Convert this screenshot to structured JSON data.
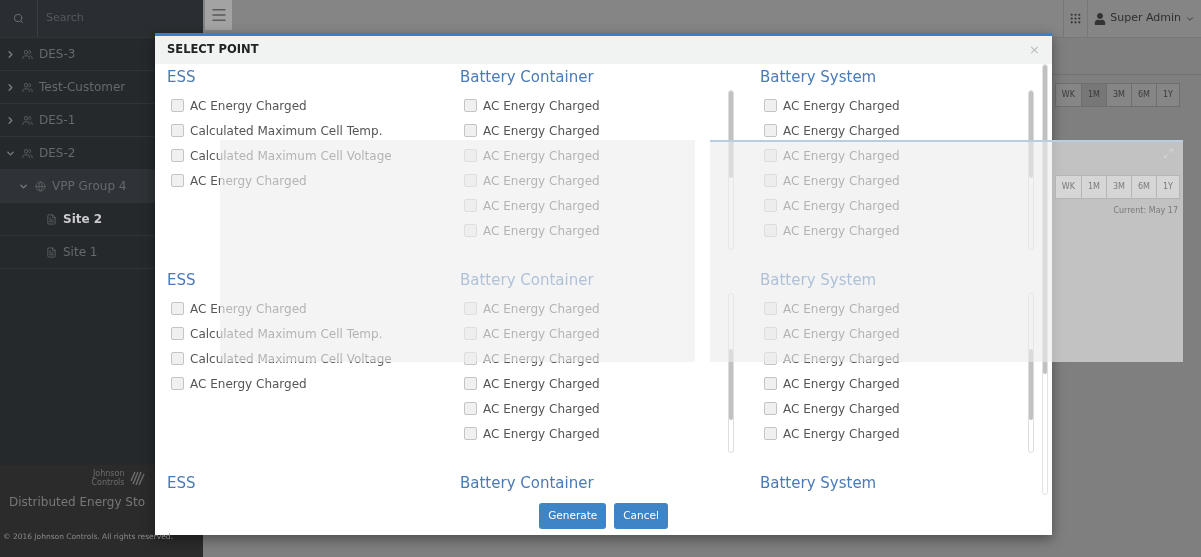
{
  "sidebar": {
    "search": {
      "placeholder": "Search"
    },
    "tree": [
      {
        "label": "DES-3",
        "kind": "customer",
        "expanded": false,
        "selected": false
      },
      {
        "label": "Test-Customer",
        "kind": "customer",
        "expanded": false,
        "selected": false
      },
      {
        "label": "DES-1",
        "kind": "customer",
        "expanded": false,
        "selected": false
      },
      {
        "label": "DES-2",
        "kind": "customer",
        "expanded": true,
        "selected": false,
        "children": [
          {
            "label": "VPP Group 4",
            "kind": "group",
            "expanded": true,
            "selected": false,
            "children": [
              {
                "label": "Site 2",
                "kind": "site",
                "selected": true
              },
              {
                "label": "Site 1",
                "kind": "site",
                "selected": false
              }
            ]
          }
        ]
      }
    ],
    "logo_text": "Johnson Controls",
    "product": "Distributed Energy Sto",
    "copyright": "© 2016 Johnson Controls. All rights reserved."
  },
  "topbar": {
    "user": "Super Admin"
  },
  "background": {
    "range_buttons": [
      {
        "label": "WK",
        "selected": false
      },
      {
        "label": "1M",
        "selected": true
      },
      {
        "label": "3M",
        "selected": false
      },
      {
        "label": "6M",
        "selected": false
      },
      {
        "label": "1Y",
        "selected": false
      }
    ],
    "card": {
      "range_buttons": [
        {
          "label": "WK"
        },
        {
          "label": "1M"
        },
        {
          "label": "3M"
        },
        {
          "label": "6M"
        },
        {
          "label": "1Y"
        }
      ],
      "current": "Current: May 17"
    }
  },
  "modal": {
    "title": "SELECT POINT",
    "close": "×",
    "rows": [
      {
        "groups": [
          {
            "title": "ESS",
            "points": [
              {
                "label": "AC Energy Charged",
                "checked": false
              },
              {
                "label": "Calculated Maximum Cell Temp.",
                "checked": false
              },
              {
                "label": "Calculated Maximum Cell Voltage",
                "checked": false
              },
              {
                "label": "AC Energy Charged",
                "checked": false
              }
            ]
          },
          {
            "title": "Battery Container",
            "points": [
              {
                "label": "AC Energy Charged",
                "checked": false
              },
              {
                "label": "AC Energy Charged",
                "checked": false
              },
              {
                "label": "AC Energy Charged",
                "checked": false
              },
              {
                "label": "AC Energy Charged",
                "checked": false
              },
              {
                "label": "AC Energy Charged",
                "checked": false
              },
              {
                "label": "AC Energy Charged",
                "checked": false
              }
            ]
          },
          {
            "title": "Battery System",
            "points": [
              {
                "label": "AC Energy Charged",
                "checked": false
              },
              {
                "label": "AC Energy Charged",
                "checked": false
              },
              {
                "label": "AC Energy Charged",
                "checked": false
              },
              {
                "label": "AC Energy Charged",
                "checked": false
              },
              {
                "label": "AC Energy Charged",
                "checked": false
              },
              {
                "label": "AC Energy Charged",
                "checked": false
              }
            ]
          }
        ]
      },
      {
        "groups": [
          {
            "title": "ESS",
            "points": [
              {
                "label": "AC Energy Charged",
                "checked": false
              },
              {
                "label": "Calculated Maximum Cell Temp.",
                "checked": false
              },
              {
                "label": "Calculated Maximum Cell Voltage",
                "checked": false
              },
              {
                "label": "AC Energy Charged",
                "checked": false
              }
            ]
          },
          {
            "title": "Battery Container",
            "points": [
              {
                "label": "AC Energy Charged",
                "checked": false
              },
              {
                "label": "AC Energy Charged",
                "checked": false
              },
              {
                "label": "AC Energy Charged",
                "checked": false
              },
              {
                "label": "AC Energy Charged",
                "checked": false
              },
              {
                "label": "AC Energy Charged",
                "checked": false
              },
              {
                "label": "AC Energy Charged",
                "checked": false
              }
            ]
          },
          {
            "title": "Battery System",
            "points": [
              {
                "label": "AC Energy Charged",
                "checked": false
              },
              {
                "label": "AC Energy Charged",
                "checked": false
              },
              {
                "label": "AC Energy Charged",
                "checked": false
              },
              {
                "label": "AC Energy Charged",
                "checked": false
              },
              {
                "label": "AC Energy Charged",
                "checked": false
              },
              {
                "label": "AC Energy Charged",
                "checked": false
              }
            ]
          }
        ]
      },
      {
        "groups": [
          {
            "title": "ESS"
          },
          {
            "title": "Battery Container"
          },
          {
            "title": "Battery System"
          }
        ]
      }
    ],
    "buttons": [
      {
        "label": "Generate"
      },
      {
        "label": "Cancel"
      }
    ]
  }
}
